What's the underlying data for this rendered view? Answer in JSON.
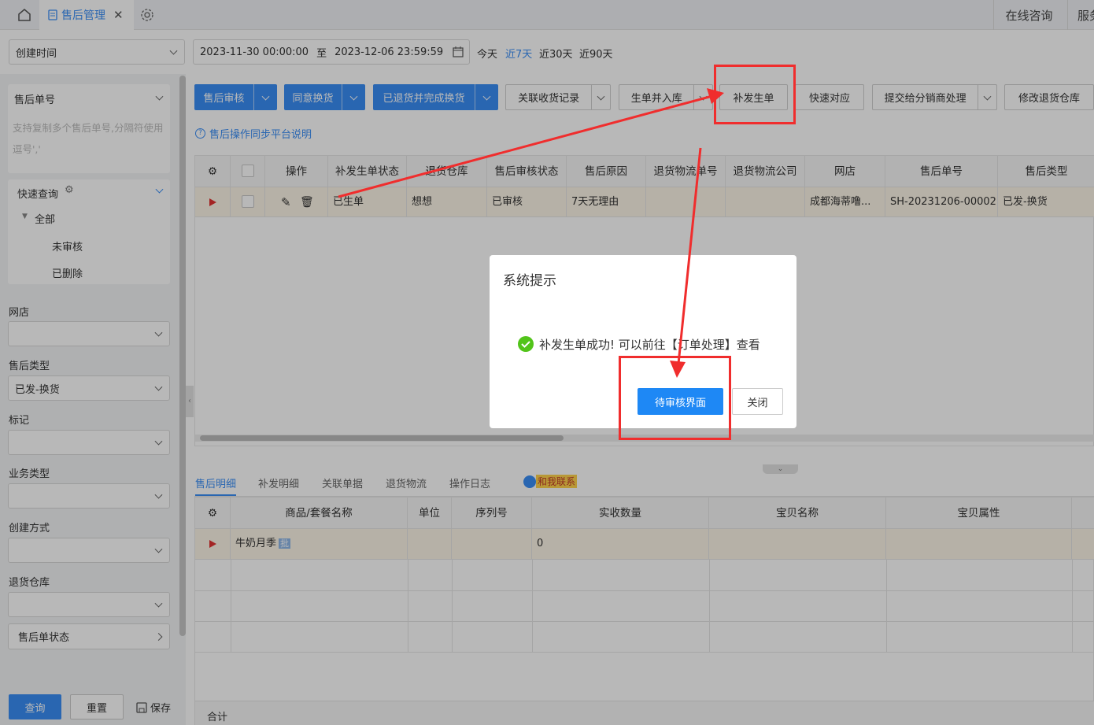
{
  "topbar": {
    "tab_label": "售后管理",
    "online": "在线咨询",
    "service": "服务"
  },
  "filter": {
    "time_type": "创建时间",
    "start": "2023-11-30 00:00:00",
    "to": "至",
    "end": "2023-12-06 23:59:59",
    "quick": [
      "今天",
      "近7天",
      "近30天",
      "近90天"
    ]
  },
  "sidebar": {
    "order_no_label": "售后单号",
    "order_no_placeholder": "支持复制多个售后单号,分隔符使用逗号','",
    "quick_query": "快速查询",
    "tree_all": "全部",
    "tree_items": [
      "未审核",
      "已删除"
    ],
    "shop_label": "网店",
    "type_label": "售后类型",
    "type_value": "已发-换货",
    "mark_label": "标记",
    "biz_label": "业务类型",
    "create_label": "创建方式",
    "wh_label": "退货仓库",
    "status_label": "售后单状态",
    "query_btn": "查询",
    "reset_btn": "重置",
    "save_btn": "保存"
  },
  "toolbar": {
    "buttons": [
      "售后审核",
      "同意换货",
      "已退货并完成换货",
      "关联收货记录",
      "生单并入库",
      "补发生单",
      "快速对应",
      "提交给分销商处理",
      "修改退货仓库"
    ],
    "help": "售后操作同步平台说明"
  },
  "grid": {
    "headers": [
      "操作",
      "补发生单状态",
      "退货仓库",
      "售后审核状态",
      "售后原因",
      "退货物流单号",
      "退货物流公司",
      "网店",
      "售后单号",
      "售后类型"
    ],
    "row": [
      "已生单",
      "想想",
      "已审核",
      "7天无理由",
      "",
      "",
      "成都海蒂噜...",
      "SH-20231206-00002",
      "已发-换货"
    ]
  },
  "detail": {
    "tabs": [
      "售后明细",
      "补发明细",
      "关联单据",
      "退货物流",
      "操作日志"
    ],
    "contact": "和我联系",
    "headers": [
      "商品/套餐名称",
      "单位",
      "序列号",
      "实收数量",
      "宝贝名称",
      "宝贝属性"
    ],
    "row": {
      "name": "牛奶月季",
      "badge": "批",
      "qty": "0"
    },
    "total": "合计"
  },
  "dialog": {
    "title": "系统提示",
    "message": "补发生单成功! 可以前往【订单处理】查看",
    "primary": "待审核界面",
    "close": "关闭"
  },
  "colors": {
    "primary": "#3a8ef6",
    "annotation": "#f02d2d",
    "success": "#52c41a"
  }
}
